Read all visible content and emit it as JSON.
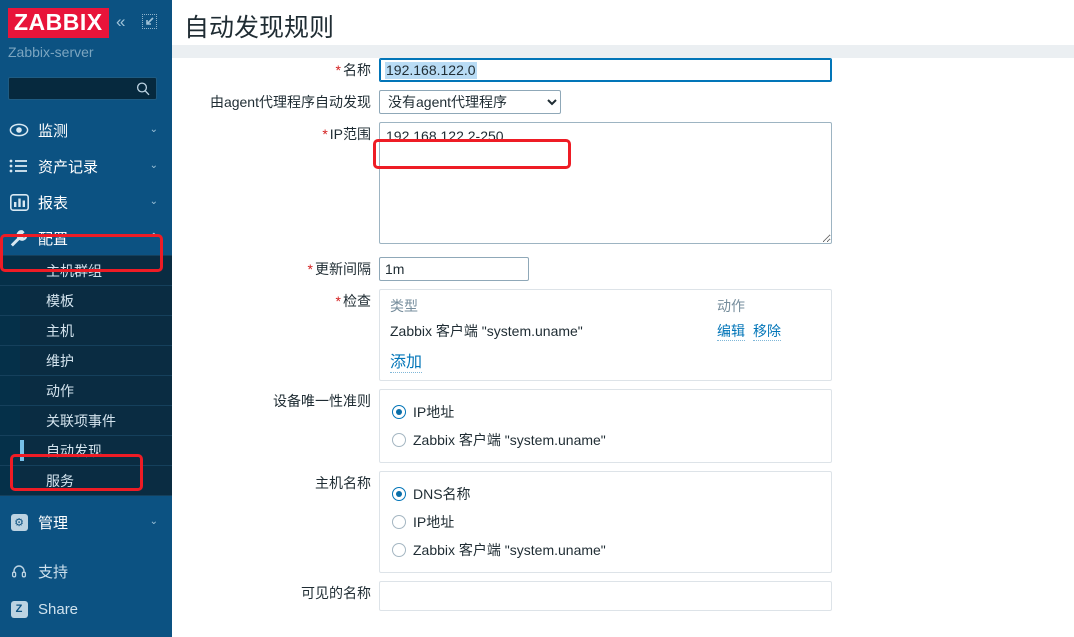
{
  "sidebar": {
    "logo": "ZABBIX",
    "collapse_icon": "chevron-double-left-icon",
    "hide_icon": "collapse-sidebar-icon",
    "server_name": "Zabbix-server",
    "search_placeholder": "",
    "search_icon": "search-icon",
    "menu": [
      {
        "label": "监测",
        "icon": "eye-icon",
        "arrow": "⌄",
        "expanded": false
      },
      {
        "label": "资产记录",
        "icon": "list-icon",
        "arrow": "⌄",
        "expanded": false
      },
      {
        "label": "报表",
        "icon": "chart-bar-icon",
        "arrow": "⌄",
        "expanded": false
      },
      {
        "label": "配置",
        "icon": "wrench-icon",
        "arrow": "⌃",
        "expanded": true
      }
    ],
    "submenu": [
      {
        "label": "主机群组",
        "selected": false
      },
      {
        "label": "模板",
        "selected": false
      },
      {
        "label": "主机",
        "selected": false
      },
      {
        "label": "维护",
        "selected": false
      },
      {
        "label": "动作",
        "selected": false
      },
      {
        "label": "关联项事件",
        "selected": false
      },
      {
        "label": "自动发现",
        "selected": true
      },
      {
        "label": "服务",
        "selected": false
      }
    ],
    "admin": {
      "label": "管理",
      "icon": "gear-box-icon",
      "arrow": "⌄"
    },
    "footer": [
      {
        "label": "支持",
        "icon": "headset-icon"
      },
      {
        "label": "Share",
        "icon": "zabbix-z-icon"
      }
    ]
  },
  "main": {
    "page_title": "自动发现规则",
    "form": {
      "name": {
        "label": "名称",
        "required": true,
        "value": "192.168.122.0",
        "selected": true
      },
      "proxy": {
        "label": "由agent代理程序自动发现",
        "required": false,
        "value": "没有agent代理程序",
        "options": [
          "没有agent代理程序"
        ]
      },
      "ip_range": {
        "label": "IP范围",
        "required": true,
        "value": "192.168.122.2-250",
        "resize_handle": "resize-grip-icon"
      },
      "delay": {
        "label": "更新间隔",
        "required": true,
        "value": "1m"
      },
      "checks": {
        "label": "检查",
        "required": true,
        "columns": [
          "类型",
          "动作"
        ],
        "rows": [
          {
            "type": "Zabbix 客户端 \"system.uname\"",
            "edit": "编辑",
            "remove": "移除"
          }
        ],
        "add_label": "添加"
      },
      "device_uniqueness": {
        "label": "设备唯一性准则",
        "required": false,
        "options": [
          {
            "label": "IP地址",
            "checked": true
          },
          {
            "label": "Zabbix 客户端 \"system.uname\"",
            "checked": false
          }
        ]
      },
      "host_name": {
        "label": "主机名称",
        "required": false,
        "options": [
          {
            "label": "DNS名称",
            "checked": true
          },
          {
            "label": "IP地址",
            "checked": false
          },
          {
            "label": "Zabbix 客户端 \"system.uname\"",
            "checked": false
          }
        ]
      },
      "visible_name": {
        "label": "可见的名称",
        "required": false
      }
    }
  },
  "annotations": {
    "highlight_color": "#ee1c25",
    "boxes": [
      "config-menu",
      "discovery-menu",
      "ip-range-field"
    ]
  }
}
